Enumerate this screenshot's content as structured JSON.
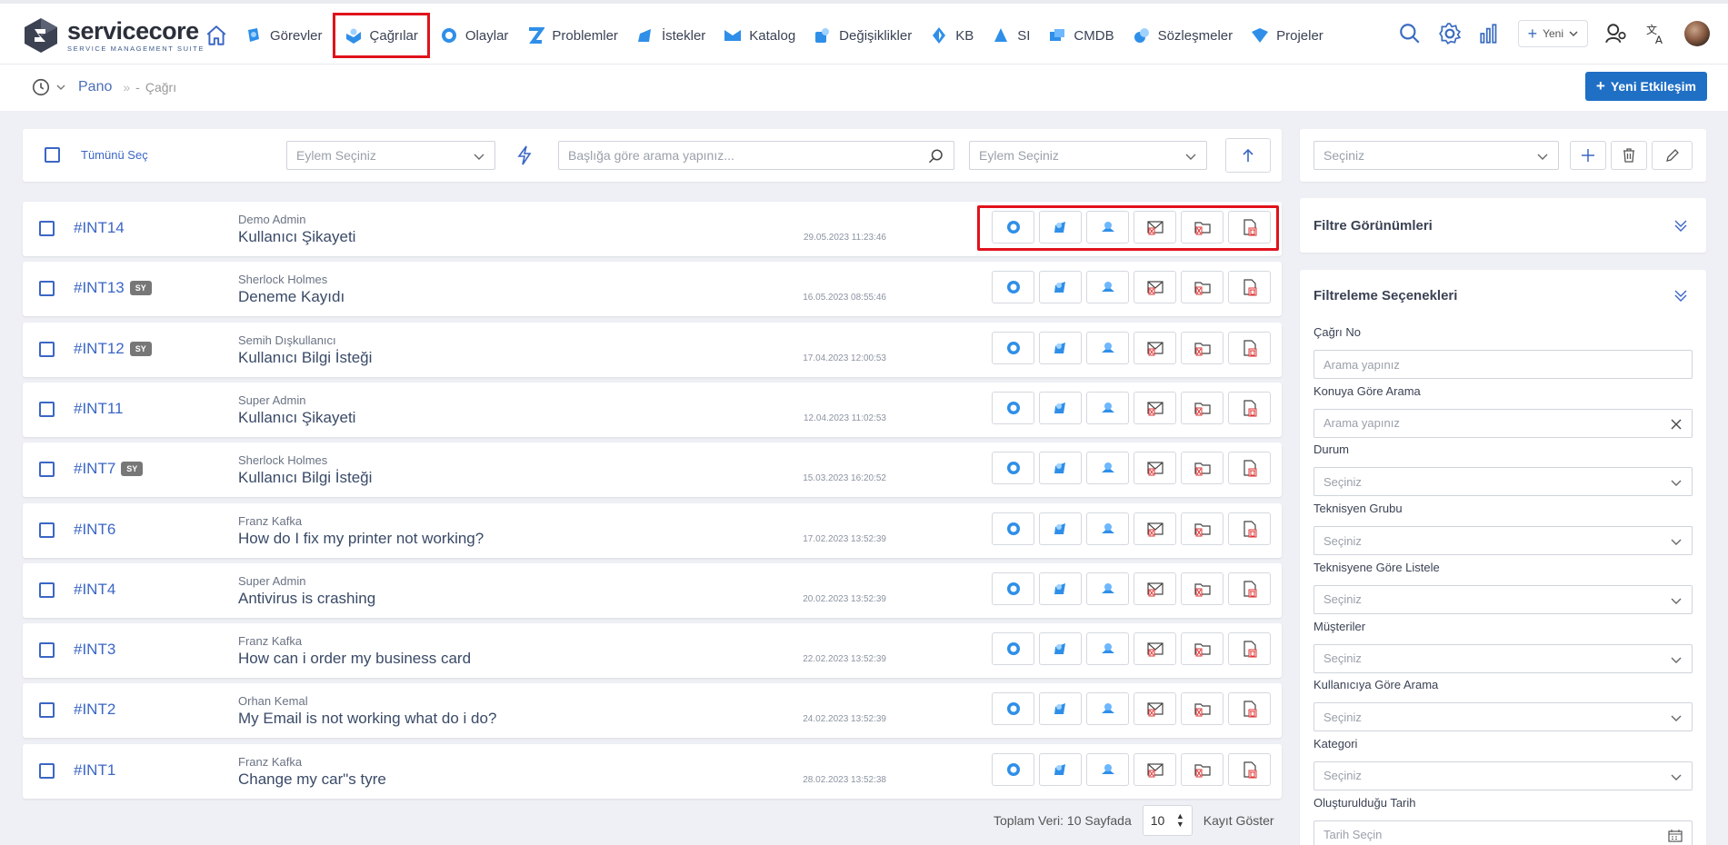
{
  "app": {
    "name": "servicecore",
    "subtitle": "SERVICE MANAGEMENT SUITE"
  },
  "nav": [
    {
      "label": "Görevler",
      "icon": "tasks-icon",
      "color": "#2f8fe8"
    },
    {
      "label": "Çağrılar",
      "icon": "calls-icon",
      "color": "#2f8fe8",
      "active": true
    },
    {
      "label": "Olaylar",
      "icon": "incidents-icon",
      "color": "#2f8fe8"
    },
    {
      "label": "Problemler",
      "icon": "problems-icon",
      "color": "#2f8fe8"
    },
    {
      "label": "İstekler",
      "icon": "requests-icon",
      "color": "#2f8fe8"
    },
    {
      "label": "Katalog",
      "icon": "catalog-icon",
      "color": "#2f8fe8"
    },
    {
      "label": "Değişiklikler",
      "icon": "changes-icon",
      "color": "#2f8fe8"
    },
    {
      "label": "KB",
      "icon": "kb-icon",
      "color": "#2f8fe8"
    },
    {
      "label": "SI",
      "icon": "si-icon",
      "color": "#2f8fe8"
    },
    {
      "label": "CMDB",
      "icon": "cmdb-icon",
      "color": "#2f8fe8"
    },
    {
      "label": "Sözleşmeler",
      "icon": "contracts-icon",
      "color": "#2f8fe8"
    },
    {
      "label": "Projeler",
      "icon": "projects-icon",
      "color": "#2f8fe8"
    }
  ],
  "tools": {
    "new_label": "Yeni"
  },
  "breadcrumb": {
    "root": "Pano",
    "current": "Çağrı"
  },
  "new_interaction": "Yeni Etkileşim",
  "toolbar": {
    "select_all": "Tümünü Seç",
    "action_select": "Eylem Seçiniz",
    "search_placeholder": "Başlığa göre arama yapınız...",
    "action_select2": "Eylem Seçiniz"
  },
  "view_toolbar": {
    "select": "Seçiniz"
  },
  "rows": [
    {
      "id": "#INT14",
      "badge": "",
      "user": "Demo Admin",
      "subject": "Kullanıcı Şikayeti",
      "date": "29.05.2023 11:23:46"
    },
    {
      "id": "#INT13",
      "badge": "SY",
      "user": "Sherlock Holmes",
      "subject": "Deneme Kayıdı",
      "date": "16.05.2023 08:55:46"
    },
    {
      "id": "#INT12",
      "badge": "SY",
      "user": "Semih Dışkullanıcı",
      "subject": "Kullanıcı Bilgi İsteği",
      "date": "17.04.2023 12:00:53"
    },
    {
      "id": "#INT11",
      "badge": "",
      "user": "Super Admin",
      "subject": "Kullanıcı Şikayeti",
      "date": "12.04.2023 11:02:53"
    },
    {
      "id": "#INT7",
      "badge": "SY",
      "user": "Sherlock Holmes",
      "subject": "Kullanıcı Bilgi İsteği",
      "date": "15.03.2023 16:20:52"
    },
    {
      "id": "#INT6",
      "badge": "",
      "user": "Franz Kafka",
      "subject": "How do I fix my printer not working?",
      "date": "17.02.2023 13:52:39"
    },
    {
      "id": "#INT4",
      "badge": "",
      "user": "Super Admin",
      "subject": "Antivirus is crashing",
      "date": "20.02.2023 13:52:39"
    },
    {
      "id": "#INT3",
      "badge": "",
      "user": "Franz Kafka",
      "subject": "How can i order my business card",
      "date": "22.02.2023 13:52:39"
    },
    {
      "id": "#INT2",
      "badge": "",
      "user": "Orhan Kemal",
      "subject": "My Email is not working what do i do?",
      "date": "24.02.2023 13:52:39"
    },
    {
      "id": "#INT1",
      "badge": "",
      "user": "Franz Kafka",
      "subject": "Change my car\"s tyre",
      "date": "28.02.2023 13:52:38"
    }
  ],
  "footer": {
    "total": "Toplam Veri: 10 Sayfada",
    "page_size": "10",
    "show": "Kayıt Göster"
  },
  "filter_views": {
    "title": "Filtre Görünümleri"
  },
  "filters": {
    "title": "Filtreleme Seçenekleri",
    "fields": [
      {
        "label": "Çağrı No",
        "placeholder": "Arama yapınız",
        "type": "text"
      },
      {
        "label": "Konuya Göre Arama",
        "placeholder": "Arama yapınız",
        "type": "clear"
      },
      {
        "label": "Durum",
        "placeholder": "Seçiniz",
        "type": "select"
      },
      {
        "label": "Teknisyen Grubu",
        "placeholder": "Seçiniz",
        "type": "select"
      },
      {
        "label": "Teknisyene Göre Listele",
        "placeholder": "Seçiniz",
        "type": "select"
      },
      {
        "label": "Müşteriler",
        "placeholder": "Seçiniz",
        "type": "select"
      },
      {
        "label": "Kullanıcıya Göre Arama",
        "placeholder": "Seçiniz",
        "type": "select"
      },
      {
        "label": "Kategori",
        "placeholder": "Seçiniz",
        "type": "select"
      },
      {
        "label": "Oluşturulduğu Tarih",
        "placeholder": "Tarih Seçin",
        "type": "date"
      }
    ]
  },
  "colors": {
    "accent": "#3b66c5",
    "primary_button": "#1f6fc5",
    "highlight": "#e0121c"
  }
}
